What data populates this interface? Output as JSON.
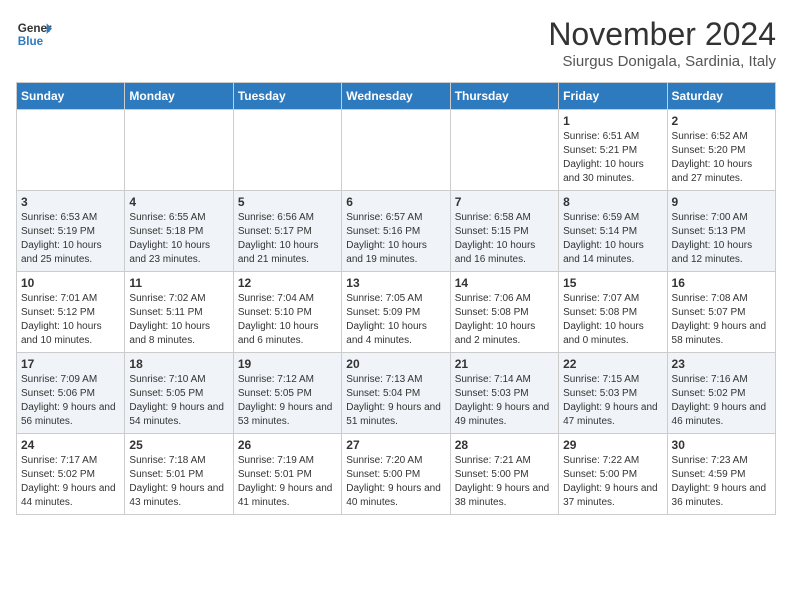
{
  "logo": {
    "line1": "General",
    "line2": "Blue"
  },
  "title": "November 2024",
  "location": "Siurgus Donigala, Sardinia, Italy",
  "days_of_week": [
    "Sunday",
    "Monday",
    "Tuesday",
    "Wednesday",
    "Thursday",
    "Friday",
    "Saturday"
  ],
  "weeks": [
    [
      {
        "day": "",
        "info": ""
      },
      {
        "day": "",
        "info": ""
      },
      {
        "day": "",
        "info": ""
      },
      {
        "day": "",
        "info": ""
      },
      {
        "day": "",
        "info": ""
      },
      {
        "day": "1",
        "info": "Sunrise: 6:51 AM\nSunset: 5:21 PM\nDaylight: 10 hours and 30 minutes."
      },
      {
        "day": "2",
        "info": "Sunrise: 6:52 AM\nSunset: 5:20 PM\nDaylight: 10 hours and 27 minutes."
      }
    ],
    [
      {
        "day": "3",
        "info": "Sunrise: 6:53 AM\nSunset: 5:19 PM\nDaylight: 10 hours and 25 minutes."
      },
      {
        "day": "4",
        "info": "Sunrise: 6:55 AM\nSunset: 5:18 PM\nDaylight: 10 hours and 23 minutes."
      },
      {
        "day": "5",
        "info": "Sunrise: 6:56 AM\nSunset: 5:17 PM\nDaylight: 10 hours and 21 minutes."
      },
      {
        "day": "6",
        "info": "Sunrise: 6:57 AM\nSunset: 5:16 PM\nDaylight: 10 hours and 19 minutes."
      },
      {
        "day": "7",
        "info": "Sunrise: 6:58 AM\nSunset: 5:15 PM\nDaylight: 10 hours and 16 minutes."
      },
      {
        "day": "8",
        "info": "Sunrise: 6:59 AM\nSunset: 5:14 PM\nDaylight: 10 hours and 14 minutes."
      },
      {
        "day": "9",
        "info": "Sunrise: 7:00 AM\nSunset: 5:13 PM\nDaylight: 10 hours and 12 minutes."
      }
    ],
    [
      {
        "day": "10",
        "info": "Sunrise: 7:01 AM\nSunset: 5:12 PM\nDaylight: 10 hours and 10 minutes."
      },
      {
        "day": "11",
        "info": "Sunrise: 7:02 AM\nSunset: 5:11 PM\nDaylight: 10 hours and 8 minutes."
      },
      {
        "day": "12",
        "info": "Sunrise: 7:04 AM\nSunset: 5:10 PM\nDaylight: 10 hours and 6 minutes."
      },
      {
        "day": "13",
        "info": "Sunrise: 7:05 AM\nSunset: 5:09 PM\nDaylight: 10 hours and 4 minutes."
      },
      {
        "day": "14",
        "info": "Sunrise: 7:06 AM\nSunset: 5:08 PM\nDaylight: 10 hours and 2 minutes."
      },
      {
        "day": "15",
        "info": "Sunrise: 7:07 AM\nSunset: 5:08 PM\nDaylight: 10 hours and 0 minutes."
      },
      {
        "day": "16",
        "info": "Sunrise: 7:08 AM\nSunset: 5:07 PM\nDaylight: 9 hours and 58 minutes."
      }
    ],
    [
      {
        "day": "17",
        "info": "Sunrise: 7:09 AM\nSunset: 5:06 PM\nDaylight: 9 hours and 56 minutes."
      },
      {
        "day": "18",
        "info": "Sunrise: 7:10 AM\nSunset: 5:05 PM\nDaylight: 9 hours and 54 minutes."
      },
      {
        "day": "19",
        "info": "Sunrise: 7:12 AM\nSunset: 5:05 PM\nDaylight: 9 hours and 53 minutes."
      },
      {
        "day": "20",
        "info": "Sunrise: 7:13 AM\nSunset: 5:04 PM\nDaylight: 9 hours and 51 minutes."
      },
      {
        "day": "21",
        "info": "Sunrise: 7:14 AM\nSunset: 5:03 PM\nDaylight: 9 hours and 49 minutes."
      },
      {
        "day": "22",
        "info": "Sunrise: 7:15 AM\nSunset: 5:03 PM\nDaylight: 9 hours and 47 minutes."
      },
      {
        "day": "23",
        "info": "Sunrise: 7:16 AM\nSunset: 5:02 PM\nDaylight: 9 hours and 46 minutes."
      }
    ],
    [
      {
        "day": "24",
        "info": "Sunrise: 7:17 AM\nSunset: 5:02 PM\nDaylight: 9 hours and 44 minutes."
      },
      {
        "day": "25",
        "info": "Sunrise: 7:18 AM\nSunset: 5:01 PM\nDaylight: 9 hours and 43 minutes."
      },
      {
        "day": "26",
        "info": "Sunrise: 7:19 AM\nSunset: 5:01 PM\nDaylight: 9 hours and 41 minutes."
      },
      {
        "day": "27",
        "info": "Sunrise: 7:20 AM\nSunset: 5:00 PM\nDaylight: 9 hours and 40 minutes."
      },
      {
        "day": "28",
        "info": "Sunrise: 7:21 AM\nSunset: 5:00 PM\nDaylight: 9 hours and 38 minutes."
      },
      {
        "day": "29",
        "info": "Sunrise: 7:22 AM\nSunset: 5:00 PM\nDaylight: 9 hours and 37 minutes."
      },
      {
        "day": "30",
        "info": "Sunrise: 7:23 AM\nSunset: 4:59 PM\nDaylight: 9 hours and 36 minutes."
      }
    ]
  ]
}
